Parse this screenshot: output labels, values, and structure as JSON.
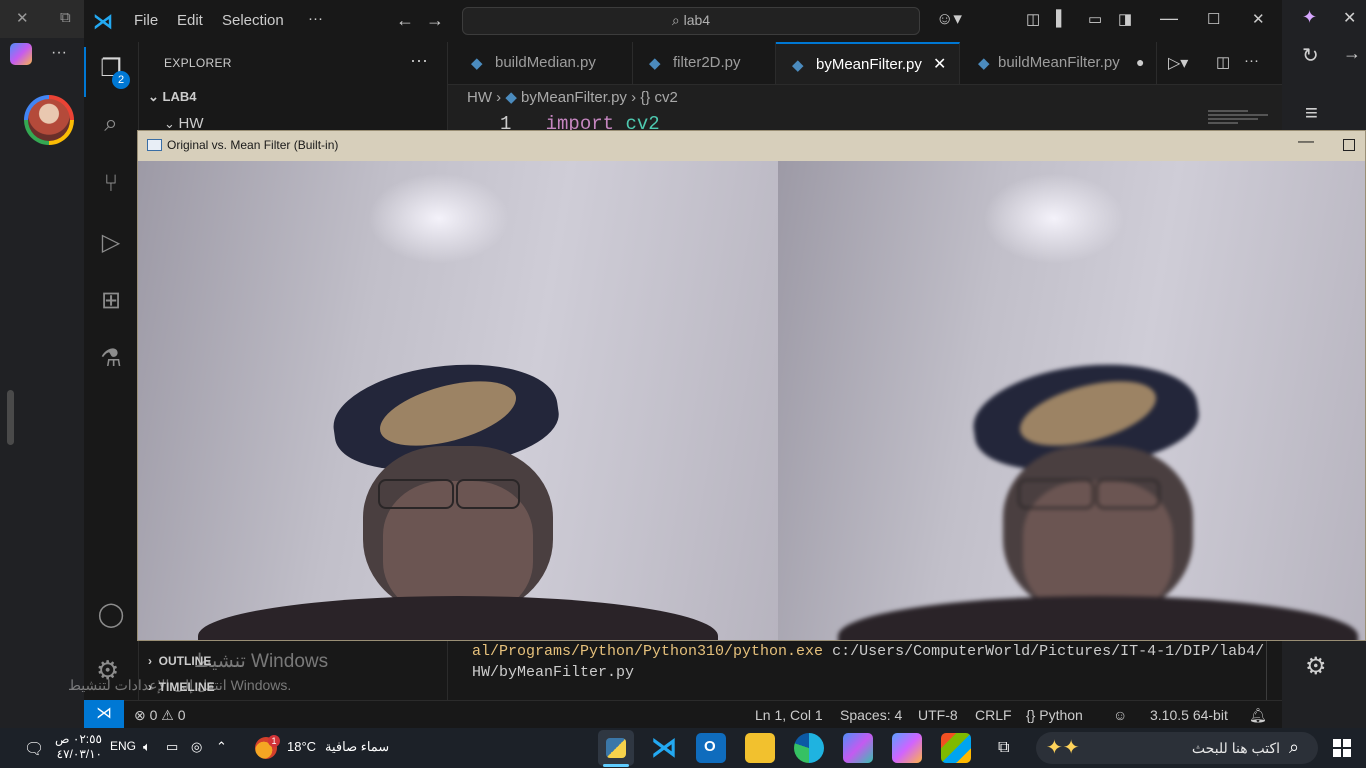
{
  "titlebar": {
    "menus": [
      "File",
      "Edit",
      "Selection"
    ],
    "more": "···",
    "search_text": "lab4"
  },
  "activity": {
    "explorer_badge": "2"
  },
  "explorer": {
    "title": "EXPLORER",
    "more": "···",
    "root": "LAB4",
    "folder": "HW",
    "outline": "OUTLINE",
    "timeline": "TIMELINE"
  },
  "tabs": [
    {
      "label": "buildMedian.py",
      "active": false
    },
    {
      "label": "filter2D.py",
      "active": false
    },
    {
      "label": "byMeanFilter.py",
      "active": true
    },
    {
      "label": "buildMeanFilter.py",
      "active": false
    }
  ],
  "breadcrumb": {
    "folder": "HW",
    "file": "byMeanFilter.py",
    "symbol": "cv2"
  },
  "editor": {
    "line_number": "1",
    "keyword": "import",
    "module": "cv2"
  },
  "cv_window": {
    "title": "Original vs. Mean Filter (Built-in)"
  },
  "terminal": {
    "line1_path": "al/Programs/Python/Python310/python.exe",
    "line1_arg": " c:/Users/ComputerWorld/Pictures/IT-4-1/DIP/lab4/",
    "line2": "HW/byMeanFilter.py"
  },
  "watermark": {
    "line1": "تنشيط Windows",
    "line2": "انتقل إلى الإعدادات لتنشيط Windows."
  },
  "statusbar": {
    "errors": "0",
    "warnings": "0",
    "position": "Ln 1, Col 1",
    "spaces": "Spaces: 4",
    "encoding": "UTF-8",
    "eol": "CRLF",
    "language": "Python",
    "interpreter": "3.10.5 64-bit"
  },
  "taskbar": {
    "time": "٠٢:٥٥ ص",
    "date": "٤٧/٠٣/١٠",
    "lang": "ENG",
    "temperature": "18°C",
    "weather": "سماء صافية",
    "weather_badge": "1",
    "search_placeholder": "اكتب هنا للبحث"
  },
  "colors": {
    "accent": "#0078d4",
    "keyword": "#c586c0",
    "module": "#4ec9b0",
    "terminal_path": "#e5c07b"
  }
}
